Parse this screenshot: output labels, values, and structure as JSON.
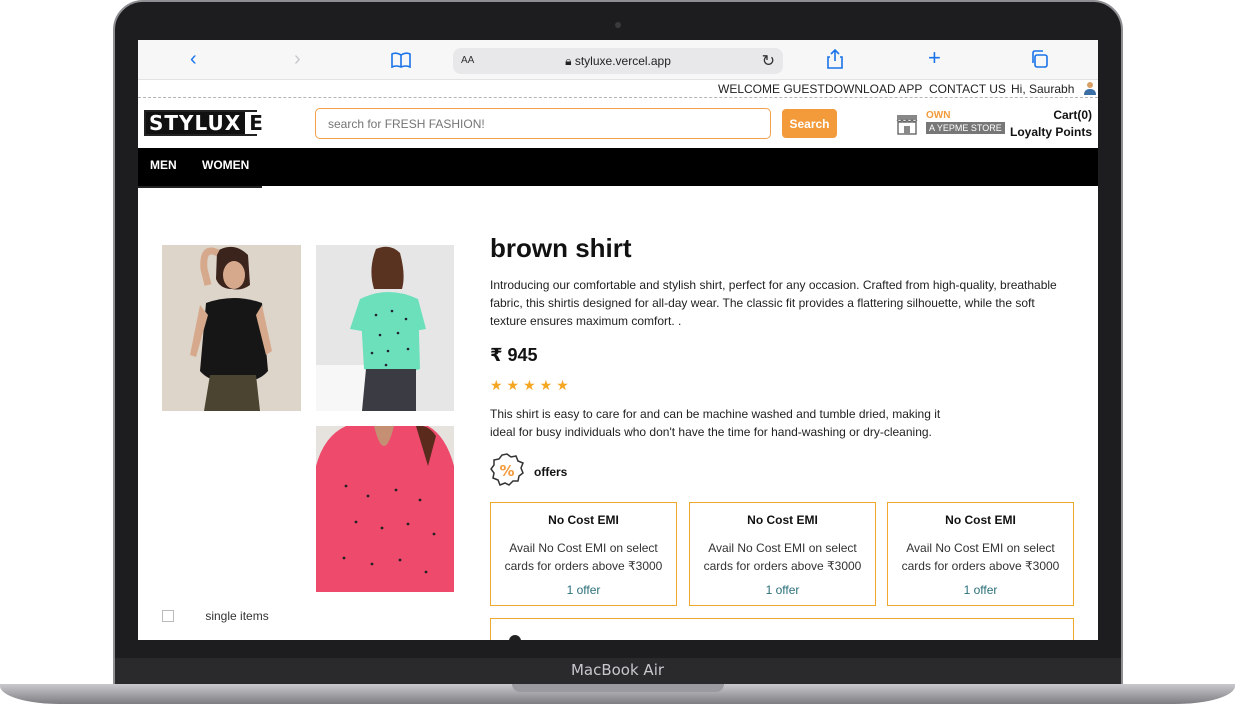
{
  "device": {
    "label": "MacBook Air"
  },
  "browser": {
    "text_size_label": "AA",
    "url": "styluxe.vercel.app"
  },
  "top_links": {
    "welcome": "WELCOME GUEST",
    "download": "DOWNLOAD APP",
    "contact": "CONTACT US",
    "greeting": "Hi, Saurabh"
  },
  "header": {
    "logo_main": "STYLUX",
    "logo_end": "E",
    "search_placeholder": "search for FRESH FASHION!",
    "search_button": "Search",
    "own_label": "OWN",
    "store_label": "A YEPME STORE",
    "cart": "Cart(0)",
    "loyalty": "Loyalty Points"
  },
  "nav": {
    "items": [
      "MEN",
      "WOMEN"
    ]
  },
  "product": {
    "title": "brown shirt",
    "description": "Introducing our comfortable and stylish shirt, perfect for any occasion. Crafted from high-quality, breathable fabric, this shirtis designed for all-day wear. The classic fit provides a flattering silhouette, while the soft texture ensures maximum comfort. .",
    "price": "₹ 945",
    "rating": 5,
    "stars": "★★★★★",
    "care": "This shirt is easy to care for and can be machine washed and tumble dried, making it ideal for busy individuals who don't have the time for hand-washing or dry-cleaning.",
    "single_items_alt": "single items",
    "offers_label": "offers",
    "offers_icon": "%",
    "offer_cards": [
      {
        "title": "No Cost EMI",
        "desc": "Avail No Cost EMI on select cards for orders above ₹3000",
        "count": "1 offer"
      },
      {
        "title": "No Cost EMI",
        "desc": "Avail No Cost EMI on select cards for orders above ₹3000",
        "count": "1 offer"
      },
      {
        "title": "No Cost EMI",
        "desc": "Avail No Cost EMI on select cards for orders above ₹3000",
        "count": "1 offer"
      }
    ]
  },
  "colors": {
    "accent": "#f39a3a",
    "card_border": "#f0a830",
    "offer_link": "#2a6f7a",
    "star": "#f5a623"
  }
}
